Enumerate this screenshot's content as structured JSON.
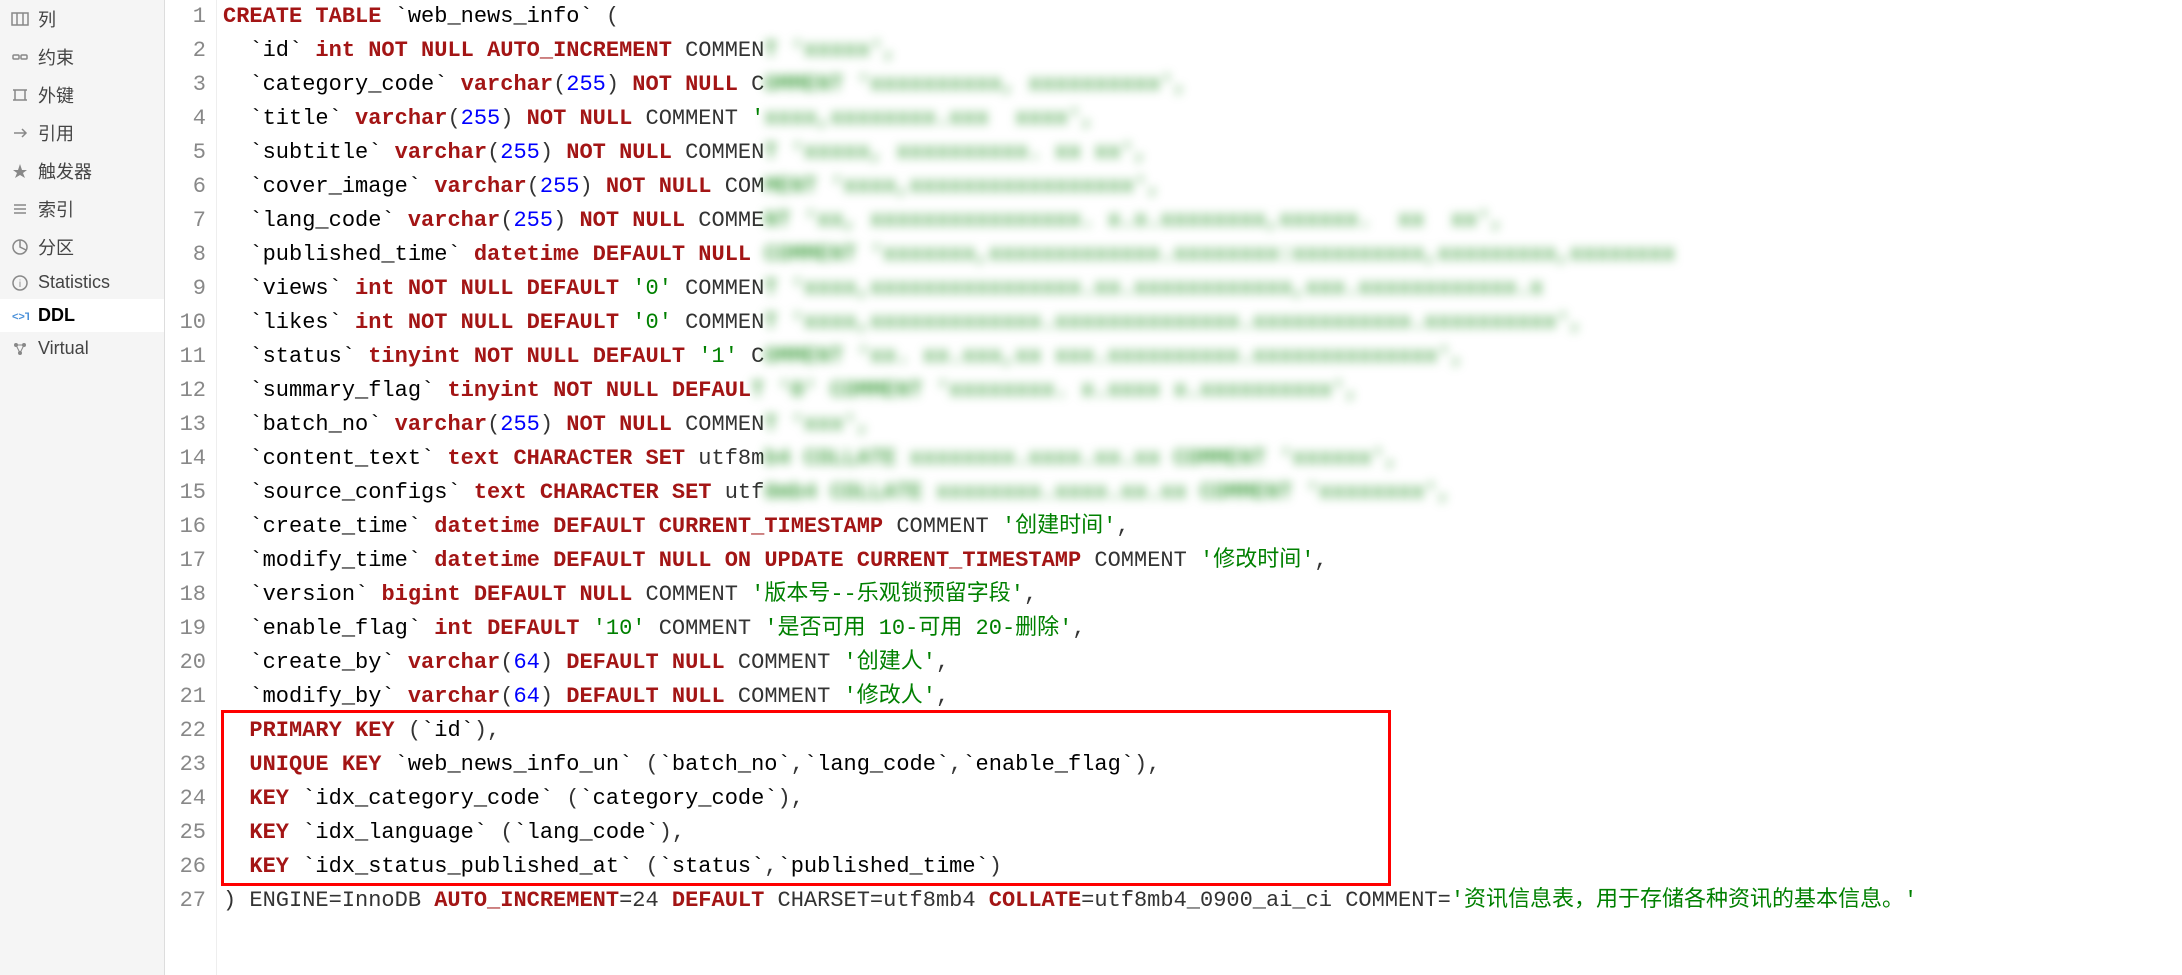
{
  "sidebar": {
    "items": [
      {
        "label": "列",
        "icon": "columns"
      },
      {
        "label": "约束",
        "icon": "constraints"
      },
      {
        "label": "外键",
        "icon": "foreign-keys"
      },
      {
        "label": "引用",
        "icon": "references"
      },
      {
        "label": "触发器",
        "icon": "triggers"
      },
      {
        "label": "索引",
        "icon": "indexes"
      },
      {
        "label": "分区",
        "icon": "partitions"
      },
      {
        "label": "Statistics",
        "icon": "statistics"
      },
      {
        "label": "DDL",
        "icon": "ddl",
        "active": true
      },
      {
        "label": "Virtual",
        "icon": "virtual"
      }
    ]
  },
  "code_lines": 27,
  "tokens": {
    "create_table": "CREATE TABLE",
    "table_name": "web_news_info",
    "bt": "`",
    "lp": " (",
    "rp": ")",
    "col_id": "id",
    "col_category_code": "category_code",
    "col_title": "title",
    "col_subtitle": "subtitle",
    "col_cover_image": "cover_image",
    "col_lang_code": "lang_code",
    "col_published_time": "published_time",
    "col_views": "views",
    "col_likes": "likes",
    "col_status": "status",
    "col_summary_flag": "summary_flag",
    "col_batch_no": "batch_no",
    "col_content_text": "content_text",
    "col_source_configs": "source_configs",
    "col_create_time": "create_time",
    "col_modify_time": "modify_time",
    "col_version": "version",
    "col_enable_flag": "enable_flag",
    "col_create_by": "create_by",
    "col_modify_by": "modify_by",
    "t_int": "int",
    "t_varchar": "varchar",
    "t_datetime": "datetime",
    "t_tinyint": "tinyint",
    "t_text": "text",
    "t_bigint": "bigint",
    "len255": "255",
    "len64": "64",
    "not_null": "NOT NULL",
    "auto_inc": "AUTO_INCREMENT",
    "default": "DEFAULT",
    "default_null": "DEFAULT NULL",
    "default_cur": "DEFAULT CURRENT_TIMESTAMP",
    "on_update_cur": "ON UPDATE CURRENT_TIMESTAMP",
    "character_set": "CHARACTER SET",
    "utf8_prefix_m": "utf8m",
    "utf8_prefix": "utf",
    "comment_kw": "COMMENT",
    "commen_": "COMMEN",
    "comme": "COMME",
    "com": "COM",
    "c": "C",
    "v0": "'0'",
    "v1": "'1'",
    "v10": "'10'",
    "comma": ",",
    "str_create_time": "'创建时间'",
    "str_modify_time": "'修改时间'",
    "str_version": "'版本号--乐观锁预留字段'",
    "str_enable": "'是否可用 10-可用 20-删除'",
    "str_create_by": "'创建人'",
    "str_modify_by": "'修改人'",
    "primary_key": "PRIMARY KEY",
    "unique_key": "UNIQUE KEY",
    "key": "KEY",
    "idx_un": "web_news_info_un",
    "idx_category": "idx_category_code",
    "idx_language": "idx_language",
    "idx_status_pub": "idx_status_published_at",
    "engine": ") ENGINE=InnoDB ",
    "auto_inc_eq": "AUTO_INCREMENT",
    "eq24": "=24 ",
    "default_caps": "DEFAULT",
    "charset": " CHARSET=utf8mb4 ",
    "collate": "COLLATE",
    "collate_val": "=utf8mb4_0900_ai_ci ",
    "comment_eq": "COMMENT=",
    "str_table_comment": "'资讯信息表，用于存储各种资讯的基本信息。'",
    "defaul": "DEFAUL",
    "indent": "  ",
    "sp": " "
  },
  "red_box": {
    "top_line": 22,
    "bottom_line": 26
  }
}
